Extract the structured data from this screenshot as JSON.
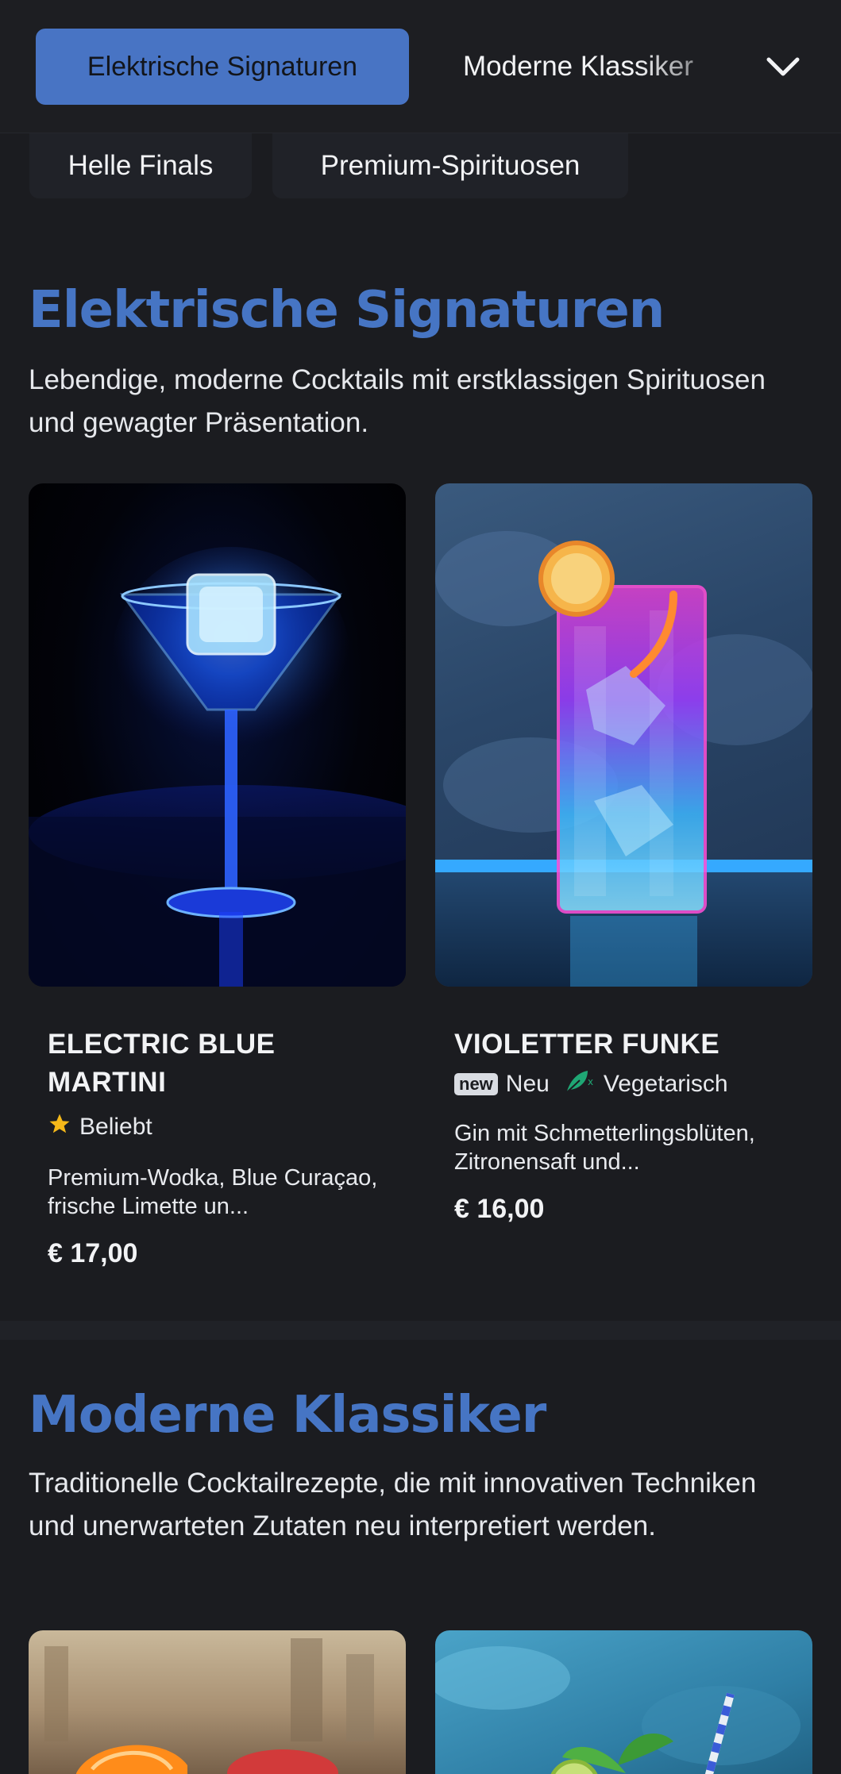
{
  "nav": {
    "active": "Elektrische Signaturen",
    "tab2": "Moderne Klassiker",
    "pill1": "Helle Finals",
    "pill2": "Premium-Spirituosen"
  },
  "sections": [
    {
      "title": "Elektrische Signaturen",
      "description": "Lebendige, moderne Cocktails mit erstklassigen Spirituosen und gewagter Präsentation.",
      "items": [
        {
          "name": "ELECTRIC BLUE MARTINI",
          "tags": [
            {
              "icon": "star-icon",
              "label": "Beliebt"
            }
          ],
          "description": "Premium-Wodka, Blue Curaçao, frische Limette un...",
          "price": "€ 17,00"
        },
        {
          "name": "VIOLETTER FUNKE",
          "tags": [
            {
              "icon": "new-badge-icon",
              "badge": "new",
              "label": "Neu"
            },
            {
              "icon": "leaf-icon",
              "label": "Vegetarisch"
            }
          ],
          "description": "Gin mit Schmetterlingsblüten, Zitronensaft und...",
          "price": "€ 16,00"
        }
      ]
    },
    {
      "title": "Moderne Klassiker",
      "description": "Traditionelle Cocktailrezepte, die mit innovativen Techniken und unerwarteten Zutaten neu interpretiert werden."
    }
  ],
  "colors": {
    "accent": "#4675c4",
    "background": "#1b1c20",
    "star": "#f5b819",
    "leaf": "#1fa774"
  }
}
